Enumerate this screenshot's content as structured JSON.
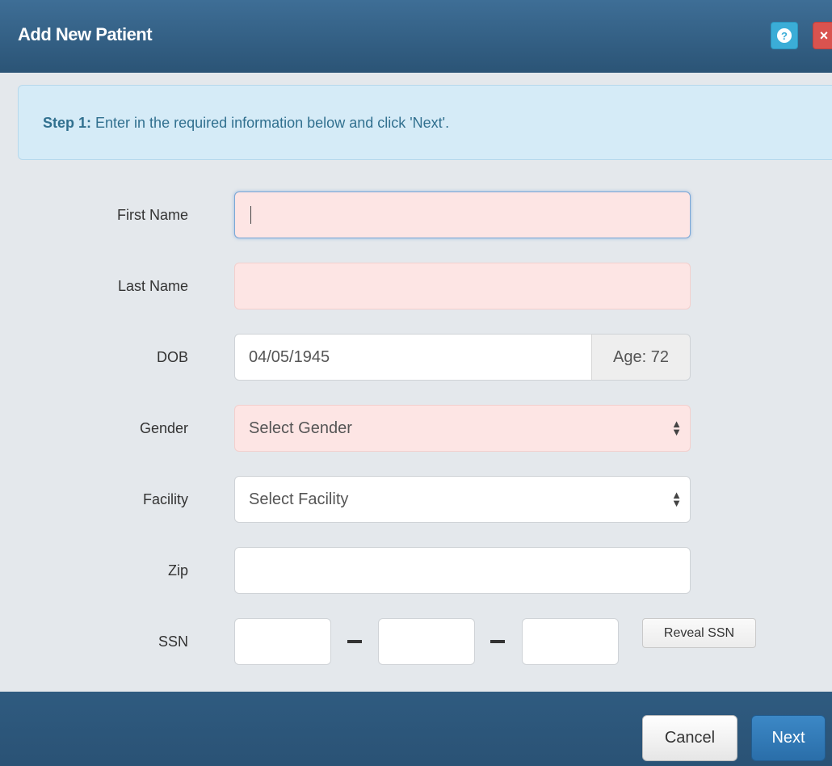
{
  "dialog": {
    "title": "Add New Patient",
    "help_icon": "question-icon",
    "close_icon": "close-icon",
    "help_glyph": "?",
    "close_glyph": "×"
  },
  "alert": {
    "step_label": "Step 1:",
    "message": " Enter in the required information below and click 'Next'."
  },
  "form": {
    "first_name": {
      "label": "First Name",
      "value": "",
      "required": true
    },
    "last_name": {
      "label": "Last Name",
      "value": "",
      "required": true
    },
    "dob": {
      "label": "DOB",
      "value": "04/05/1945",
      "age": "Age: 72"
    },
    "gender": {
      "label": "Gender",
      "selected": "Select Gender",
      "required": true
    },
    "facility": {
      "label": "Facility",
      "selected": "Select Facility"
    },
    "zip": {
      "label": "Zip",
      "value": ""
    },
    "ssn": {
      "label": "SSN",
      "part1": "",
      "part2": "",
      "part3": "",
      "reveal_label": "Reveal SSN"
    }
  },
  "footer": {
    "cancel_label": "Cancel",
    "next_label": "Next"
  },
  "colors": {
    "header": "#2b5476",
    "required_bg": "#fde5e4",
    "primary": "#2a6ea9",
    "alert_bg": "#d5ebf7"
  }
}
